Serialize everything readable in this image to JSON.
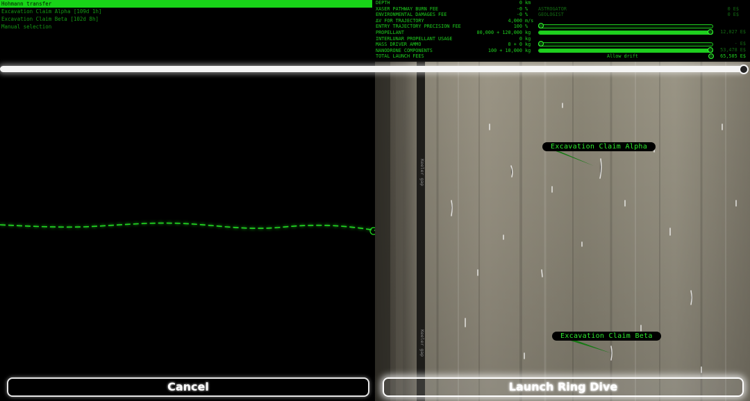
{
  "options": [
    {
      "label": "Hohmann transfer",
      "selected": true
    },
    {
      "label": "Excavation Claim Alpha [109d 1h]",
      "selected": false
    },
    {
      "label": "Excavation Claim Beta [102d 8h]",
      "selected": false
    },
    {
      "label": "Manual selection",
      "selected": false
    }
  ],
  "fees": [
    {
      "label": "DEPTH",
      "value": "0",
      "unit": "km"
    },
    {
      "label": "XASER PATHWAY BURN FEE",
      "value": "-0",
      "unit": "%"
    },
    {
      "label": "ENVIRONMENTAL DAMAGES FEE",
      "value": "-0",
      "unit": "%"
    },
    {
      "label": "ΔV FOR TRAJECTORY",
      "value": "4,000",
      "unit": "m/s"
    },
    {
      "label": "ENTRY TRAJECTORY PRECISION FEE",
      "value": "100",
      "unit": "%"
    },
    {
      "label": "PROPELLANT",
      "value": "80,000 + 120,000",
      "unit": "kg"
    },
    {
      "label": "INTERLUNAR PROPELLANT USAGE",
      "value": "0",
      "unit": "kg"
    },
    {
      "label": "MASS DRIVER AMMO",
      "value": "0 + 0",
      "unit": "kg"
    },
    {
      "label": "NANODRONE COMPONENTS",
      "value": "100 + 10,000",
      "unit": "kg"
    },
    {
      "label": "TOTAL LAUNCH FEES",
      "value": "",
      "unit": ""
    }
  ],
  "crew": {
    "astrogator_label": "ASTROGATOR",
    "astrogator_value": "0 E$",
    "geologist_label": "GEOLOGIST",
    "geologist_value": "0 E$"
  },
  "sliders": {
    "precision": {
      "level": 0.0
    },
    "propellant": {
      "level": 1.0,
      "value": "12,027 E$"
    },
    "ammo": {
      "level": 0.0,
      "value": "- E$"
    },
    "nanodrone": {
      "level": 1.0,
      "value": "53,478 E$"
    }
  },
  "allow_drift_label": "Allow drift",
  "total_value": "65,505 E$",
  "claims": {
    "alpha": "Excavation Claim Alpha",
    "beta": "Excavation Claim Beta"
  },
  "gap_label_1": "Keeler gap",
  "gap_label_2": "Keeler gap",
  "buttons": {
    "cancel": "Cancel",
    "launch": "Launch Ring Dive"
  },
  "colors": {
    "accent": "#18d418",
    "background": "#000000"
  }
}
